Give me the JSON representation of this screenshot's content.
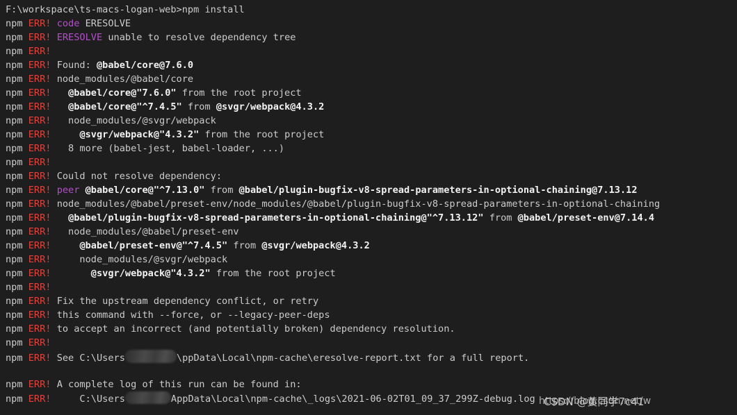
{
  "terminal": {
    "background_color": "#1e1e1e",
    "foreground_color": "#cccccc",
    "error_color": "#e8403a",
    "keyword_color": "#b44ecb",
    "package_color": "#f2f2f2",
    "prompt_line": "F:\\workspace\\ts-macs-logan-web>npm install",
    "prefix_npm": "npm",
    "prefix_err": "ERR!",
    "lines": [
      {
        "type": "prompt",
        "text": "F:\\workspace\\ts-macs-logan-web>npm install"
      },
      {
        "type": "err",
        "segments": [
          {
            "style": "kw",
            "text": "code"
          },
          {
            "style": "txt",
            "text": " ERESOLVE"
          }
        ]
      },
      {
        "type": "err",
        "segments": [
          {
            "style": "kw",
            "text": "ERESOLVE"
          },
          {
            "style": "txt",
            "text": " unable to resolve dependency tree"
          }
        ]
      },
      {
        "type": "err",
        "segments": []
      },
      {
        "type": "err",
        "segments": [
          {
            "style": "txt",
            "text": "Found: "
          },
          {
            "style": "pkg",
            "text": "@babel/core@7.6.0"
          }
        ]
      },
      {
        "type": "err",
        "segments": [
          {
            "style": "txt",
            "text": "node_modules/@babel/core"
          }
        ]
      },
      {
        "type": "err",
        "segments": [
          {
            "style": "txt",
            "text": "  "
          },
          {
            "style": "pkg",
            "text": "@babel/core@\"7.6.0\""
          },
          {
            "style": "txt",
            "text": " from the root project"
          }
        ]
      },
      {
        "type": "err",
        "segments": [
          {
            "style": "txt",
            "text": "  "
          },
          {
            "style": "pkg",
            "text": "@babel/core@\"^7.4.5\""
          },
          {
            "style": "txt",
            "text": " from "
          },
          {
            "style": "pkg",
            "text": "@svgr/webpack@4.3.2"
          }
        ]
      },
      {
        "type": "err",
        "segments": [
          {
            "style": "txt",
            "text": "  node_modules/@svgr/webpack"
          }
        ]
      },
      {
        "type": "err",
        "segments": [
          {
            "style": "txt",
            "text": "    "
          },
          {
            "style": "pkg",
            "text": "@svgr/webpack@\"4.3.2\""
          },
          {
            "style": "txt",
            "text": " from the root project"
          }
        ]
      },
      {
        "type": "err",
        "segments": [
          {
            "style": "txt",
            "text": "  8 more (babel-jest, babel-loader, ...)"
          }
        ]
      },
      {
        "type": "err",
        "segments": []
      },
      {
        "type": "err",
        "segments": [
          {
            "style": "txt",
            "text": "Could not resolve dependency:"
          }
        ]
      },
      {
        "type": "err",
        "segments": [
          {
            "style": "kw",
            "text": "peer"
          },
          {
            "style": "txt",
            "text": " "
          },
          {
            "style": "pkg",
            "text": "@babel/core@\"^7.13.0\""
          },
          {
            "style": "txt",
            "text": " from "
          },
          {
            "style": "pkg",
            "text": "@babel/plugin-bugfix-v8-spread-parameters-in-optional-chaining@7.13.12"
          }
        ]
      },
      {
        "type": "err",
        "segments": [
          {
            "style": "txt",
            "text": "node_modules/@babel/preset-env/node_modules/@babel/plugin-bugfix-v8-spread-parameters-in-optional-chaining"
          }
        ]
      },
      {
        "type": "err",
        "segments": [
          {
            "style": "txt",
            "text": "  "
          },
          {
            "style": "pkg",
            "text": "@babel/plugin-bugfix-v8-spread-parameters-in-optional-chaining@\"^7.13.12\""
          },
          {
            "style": "txt",
            "text": " from "
          },
          {
            "style": "pkg",
            "text": "@babel/preset-env@7.14.4"
          }
        ]
      },
      {
        "type": "err",
        "segments": [
          {
            "style": "txt",
            "text": "  node_modules/@babel/preset-env"
          }
        ]
      },
      {
        "type": "err",
        "segments": [
          {
            "style": "txt",
            "text": "    "
          },
          {
            "style": "pkg",
            "text": "@babel/preset-env@\"^7.4.5\""
          },
          {
            "style": "txt",
            "text": " from "
          },
          {
            "style": "pkg",
            "text": "@svgr/webpack@4.3.2"
          }
        ]
      },
      {
        "type": "err",
        "segments": [
          {
            "style": "txt",
            "text": "    node_modules/@svgr/webpack"
          }
        ]
      },
      {
        "type": "err",
        "segments": [
          {
            "style": "txt",
            "text": "      "
          },
          {
            "style": "pkg",
            "text": "@svgr/webpack@\"4.3.2\""
          },
          {
            "style": "txt",
            "text": " from the root project"
          }
        ]
      },
      {
        "type": "err",
        "segments": []
      },
      {
        "type": "err",
        "segments": [
          {
            "style": "txt",
            "text": "Fix the upstream dependency conflict, or retry"
          }
        ]
      },
      {
        "type": "err",
        "segments": [
          {
            "style": "txt",
            "text": "this command with --force, or --legacy-peer-deps"
          }
        ]
      },
      {
        "type": "err",
        "segments": [
          {
            "style": "txt",
            "text": "to accept an incorrect (and potentially broken) dependency resolution."
          }
        ]
      },
      {
        "type": "err",
        "segments": []
      },
      {
        "type": "err",
        "segments": [
          {
            "style": "txt",
            "text": "See C:\\Users"
          },
          {
            "style": "redact1",
            "text": ""
          },
          {
            "style": "txt",
            "text": "\\ppData\\Local\\npm-cache\\eresolve-report.txt for a full report."
          }
        ]
      },
      {
        "type": "blank",
        "segments": []
      },
      {
        "type": "err",
        "segments": [
          {
            "style": "txt",
            "text": "A complete log of this run can be found in:"
          }
        ]
      },
      {
        "type": "err",
        "segments": [
          {
            "style": "txt",
            "text": "    C:\\Users"
          },
          {
            "style": "redact2",
            "text": ""
          },
          {
            "style": "txt",
            "text": "AppData\\Local\\npm-cache\\_logs\\2021-06-02T01_09_37_299Z-debug.log"
          }
        ]
      }
    ],
    "redactions": [
      {
        "name": "username-redaction-1",
        "line_index": 26
      },
      {
        "name": "username-redaction-2",
        "line_index": 29
      }
    ]
  },
  "watermark": {
    "site_label": "CSDN @黄同学7c41",
    "url": "https://blog.csdn.net/w"
  }
}
